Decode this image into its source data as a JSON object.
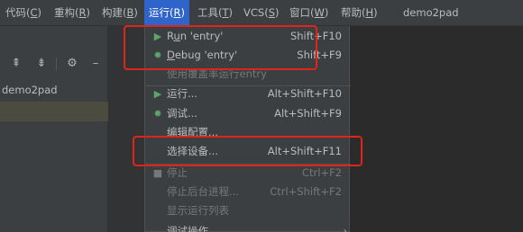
{
  "menubar": {
    "items": [
      {
        "label": "代码",
        "mnemonic": "C"
      },
      {
        "label": "重构",
        "mnemonic": "R"
      },
      {
        "label": "构建",
        "mnemonic": "B"
      },
      {
        "label": "运行",
        "mnemonic": "R"
      },
      {
        "label": "工具",
        "mnemonic": "T"
      },
      {
        "label": "VCS",
        "mnemonic": "S"
      },
      {
        "label": "窗口",
        "mnemonic": "W"
      },
      {
        "label": "帮助",
        "mnemonic": "H"
      }
    ],
    "project_title": "demo2pad"
  },
  "project_panel": {
    "project_name": "demo2pad"
  },
  "run_menu": {
    "items": [
      {
        "label_pre": "R",
        "label_u": "u",
        "label_post": "n 'entry'",
        "shortcut": "Shift+F10",
        "icon": "run-icon",
        "enabled": true
      },
      {
        "label_pre": "",
        "label_u": "D",
        "label_post": "ebug 'entry'",
        "shortcut": "Shift+F9",
        "icon": "debug-icon",
        "enabled": true
      },
      {
        "label": "使用覆盖率运行entry",
        "shortcut": "",
        "icon": "",
        "enabled": false
      },
      {
        "label": "运行...",
        "shortcut": "Alt+Shift+F10",
        "icon": "run-icon",
        "enabled": true
      },
      {
        "label": "调试...",
        "shortcut": "Alt+Shift+F9",
        "icon": "debug-icon",
        "enabled": true
      },
      {
        "label": "编辑配置...",
        "shortcut": "",
        "icon": "",
        "enabled": true
      },
      {
        "label": "选择设备...",
        "shortcut": "Alt+Shift+F11",
        "icon": "",
        "enabled": true
      },
      {
        "label": "停止",
        "shortcut": "Ctrl+F2",
        "icon": "stop-icon",
        "enabled": false
      },
      {
        "label": "停止后台进程...",
        "shortcut": "Ctrl+Shift+F2",
        "icon": "",
        "enabled": false
      },
      {
        "label": "显示运行列表",
        "shortcut": "",
        "icon": "",
        "enabled": false
      },
      {
        "label": "调试操作",
        "shortcut": "",
        "icon": "",
        "enabled": true,
        "submenu": true
      }
    ]
  },
  "annotation_color": "#e2231a",
  "accent_color": "#2f65ca"
}
